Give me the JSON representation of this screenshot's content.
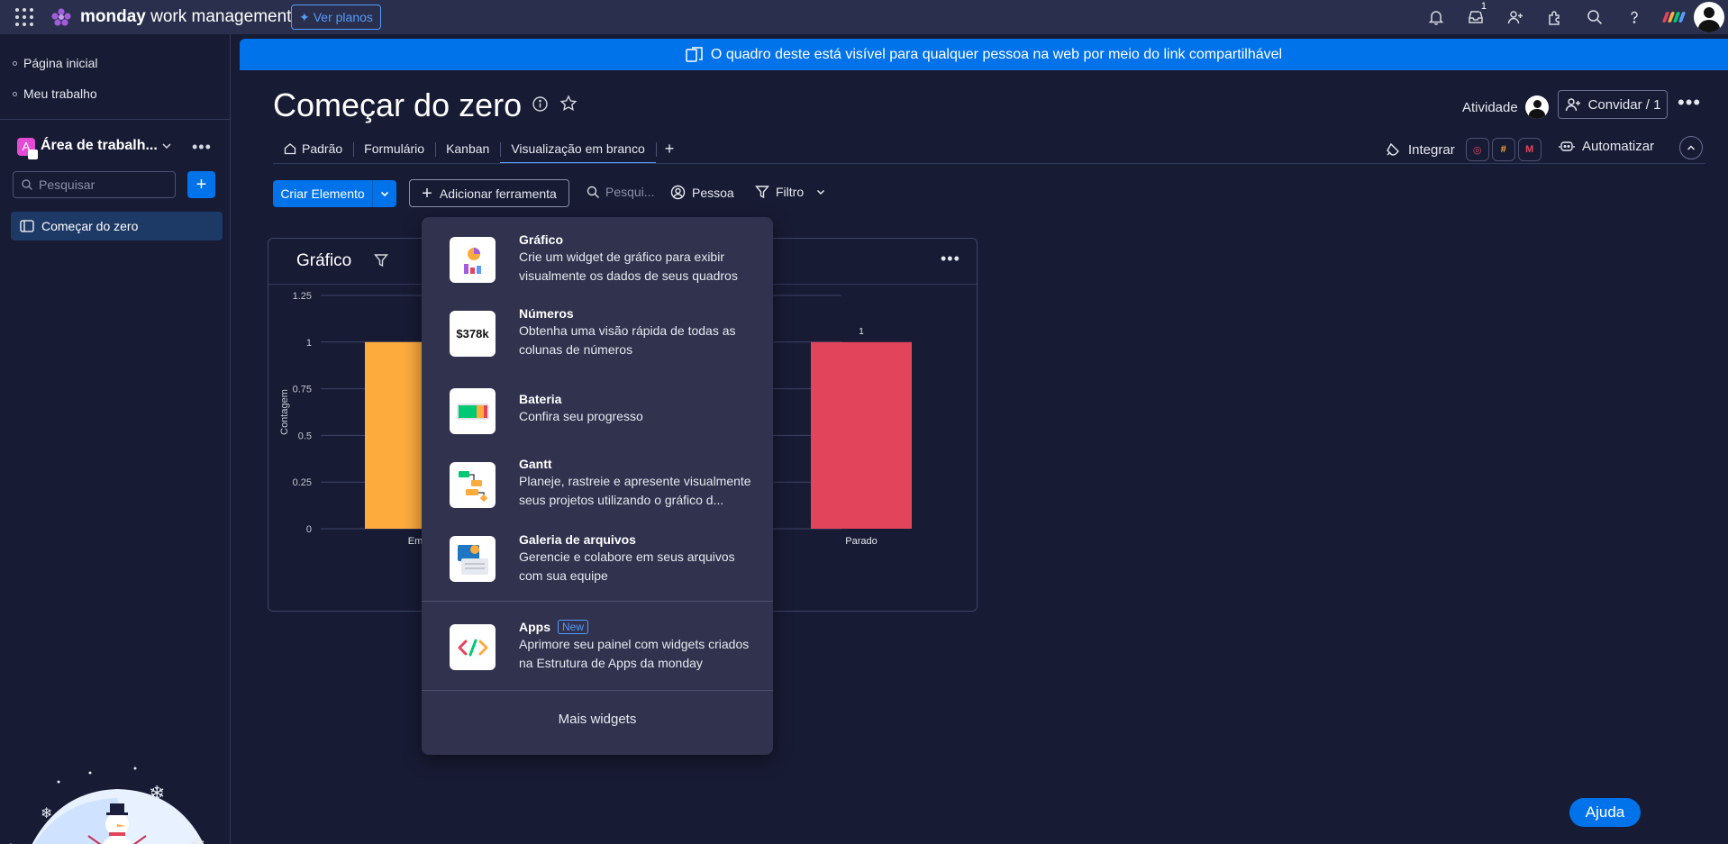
{
  "topbar": {
    "brand_bold": "monday",
    "brand_rest": " work management",
    "plans_label": "Ver planos",
    "inbox_badge": "1",
    "icons": [
      "apps-grid-icon",
      "bell-icon",
      "inbox-icon",
      "invite-user-icon",
      "integrations-icon",
      "search-icon",
      "help-icon",
      "product-switcher-icon",
      "user-avatar"
    ]
  },
  "sidebar": {
    "home": "Página inicial",
    "my_work": "Meu trabalho",
    "workspace_badge": "A",
    "workspace_name": "Área de trabalh...",
    "search_placeholder": "Pesquisar",
    "board_item": "Começar do zero"
  },
  "banner": {
    "text": "O quadro deste está visível para qualquer pessoa na web por meio do link compartilhável"
  },
  "board": {
    "title": "Começar do zero",
    "activity_label": "Atividade",
    "invite_label": "Convidar / 1",
    "tabs": [
      {
        "label": "Padrão"
      },
      {
        "label": "Formulário"
      },
      {
        "label": "Kanban"
      },
      {
        "label": "Visualização em branco"
      }
    ],
    "add_tab": "+",
    "integrate_label": "Integrar",
    "automate_label": "Automatizar"
  },
  "toolbar": {
    "create_label": "Criar Elemento",
    "add_tool_label": "Adicionar ferramenta",
    "search_placeholder": "Pesqui...",
    "person_label": "Pessoa",
    "filter_label": "Filtro"
  },
  "widget": {
    "title": "Gráfico"
  },
  "chart_data": {
    "type": "bar",
    "ylabel": "Contagem",
    "ylim": [
      0,
      1.25
    ],
    "yticks": [
      "0",
      "0.25",
      "0.5",
      "0.75",
      "1",
      "1.25"
    ],
    "categories": [
      "Em",
      "Parado"
    ],
    "values": [
      1,
      1
    ],
    "data_labels": [
      "",
      "1"
    ],
    "colors": [
      "#fdab3d",
      "#e2445c"
    ]
  },
  "dropdown": {
    "items": [
      {
        "title": "Gráfico",
        "desc": "Crie um widget de gráfico para exibir visualmente os dados de seus quadros"
      },
      {
        "title": "Números",
        "desc": "Obtenha uma visão rápida de todas as colunas de números",
        "icon_text": "$378k"
      },
      {
        "title": "Bateria",
        "desc": "Confira seu progresso"
      },
      {
        "title": "Gantt",
        "desc": "Planeje, rastreie e apresente visualmente seus projetos utilizando o gráfico d..."
      },
      {
        "title": "Galeria de arquivos",
        "desc": "Gerencie e colabore em seus arquivos com sua equipe"
      },
      {
        "title": "Apps",
        "desc": "Aprimore seu painel com widgets criados na Estrutura de Apps da monday",
        "tag": "New"
      }
    ],
    "more_label": "Mais widgets"
  },
  "help": {
    "label": "Ajuda"
  }
}
